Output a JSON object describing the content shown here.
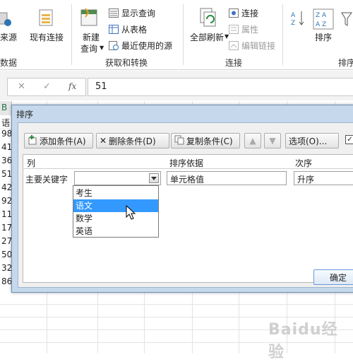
{
  "ribbon": {
    "data_source_partial": "来源",
    "existing_connections": "现有连接",
    "new_query_line1": "新建",
    "new_query_line2": "查询",
    "show_queries": "显示查询",
    "from_table": "从表格",
    "recent_sources": "最近使用的源",
    "refresh_all": "全部刷新",
    "connections": "连接",
    "properties": "属性",
    "edit_links": "编辑链接",
    "sort_label": "排序",
    "group_data_partial": "数据",
    "group_get_transform": "获取和转换",
    "group_connections": "连接",
    "group_sort_partial": "排序"
  },
  "formula_bar": {
    "cancel_glyph": "✕",
    "enter_glyph": "✓",
    "fx_label": "fx",
    "value": "51"
  },
  "sheet": {
    "column_header_partial": "B",
    "header_cell_partial": "语",
    "visible_cells": [
      "98",
      "41",
      "36",
      "51",
      "42",
      "92",
      "11",
      "17",
      "27",
      "50",
      "32",
      "86"
    ]
  },
  "dialog": {
    "title": "排序",
    "toolbar": {
      "add_condition": "添加条件(A)",
      "delete_condition": "删除条件(D)",
      "copy_condition": "复制条件(C)",
      "options": "选项(O)..."
    },
    "headers": {
      "column": "列",
      "sort_on": "排序依据",
      "order": "次序"
    },
    "row": {
      "label": "主要关键字",
      "column_value": "",
      "sort_on_value": "单元格值",
      "order_value": "升序"
    },
    "dropdown_options": [
      "考生",
      "语文",
      "数学",
      "英语"
    ],
    "dropdown_selected": "语文",
    "ok": "确定"
  },
  "watermark": "Baidu经验",
  "colors": {
    "selection": "#3399ff",
    "dialog_frame": "#c5d8ec",
    "green_accent": "#217346"
  }
}
